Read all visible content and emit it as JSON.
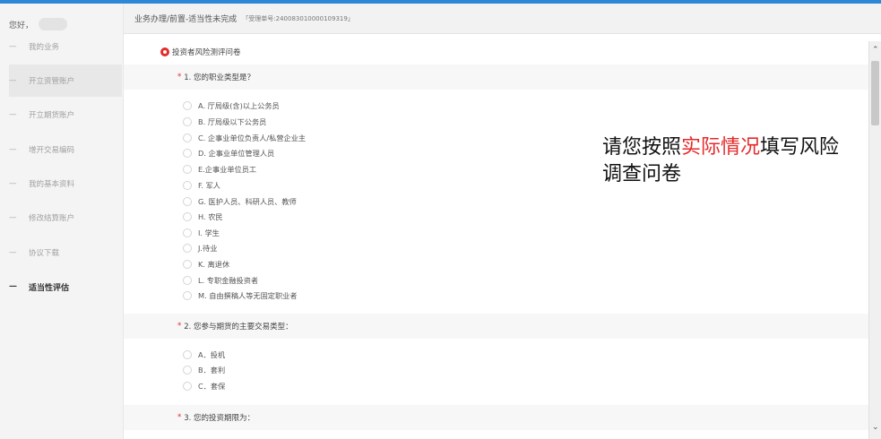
{
  "sidebar": {
    "greeting": "您好，",
    "items": [
      {
        "label": "我的业务"
      },
      {
        "label": "开立资管账户"
      },
      {
        "label": "开立期货账户"
      },
      {
        "label": "增开交易编码"
      },
      {
        "label": "我的基本资料"
      },
      {
        "label": "修改结算账户"
      },
      {
        "label": "协议下载"
      },
      {
        "label": "适当性评估"
      }
    ]
  },
  "header": {
    "breadcrumb": "业务办理/前置-适当性未完成",
    "order_number": "「受理单号:240083010000109319」"
  },
  "survey": {
    "title": "投资者风险测评问卷",
    "questions": [
      {
        "required": "*",
        "label": "1. 您的职业类型是？",
        "options": [
          "A. 厅局级(含)以上公务员",
          "B. 厅局级以下公务员",
          "C. 企事业单位负责人/私营企业主",
          "D. 企事业单位管理人员",
          "E.企事业单位员工",
          "F. 军人",
          "G. 医护人员、科研人员、教师",
          "H. 农民",
          "I. 学生",
          "J.待业",
          "K. 离退休",
          "L. 专职金融投资者",
          "M. 自由撰稿人等无固定职业者"
        ]
      },
      {
        "required": "*",
        "label": "2. 您参与期货的主要交易类型：",
        "options": [
          "A．投机",
          "B．套利",
          "C．套保"
        ]
      },
      {
        "required": "*",
        "label": "3. 您的投资期限为：",
        "options": []
      }
    ]
  },
  "notice": {
    "part1": "请您按照",
    "highlight": "实际情况",
    "part2": "填写风险调查问卷"
  },
  "scrollbar": {
    "up": "⌃",
    "down": "⌄"
  },
  "colors": {
    "accent": "#2e86d8",
    "required": "#e52a2a",
    "sidebar_bg": "#f4f4f4"
  }
}
